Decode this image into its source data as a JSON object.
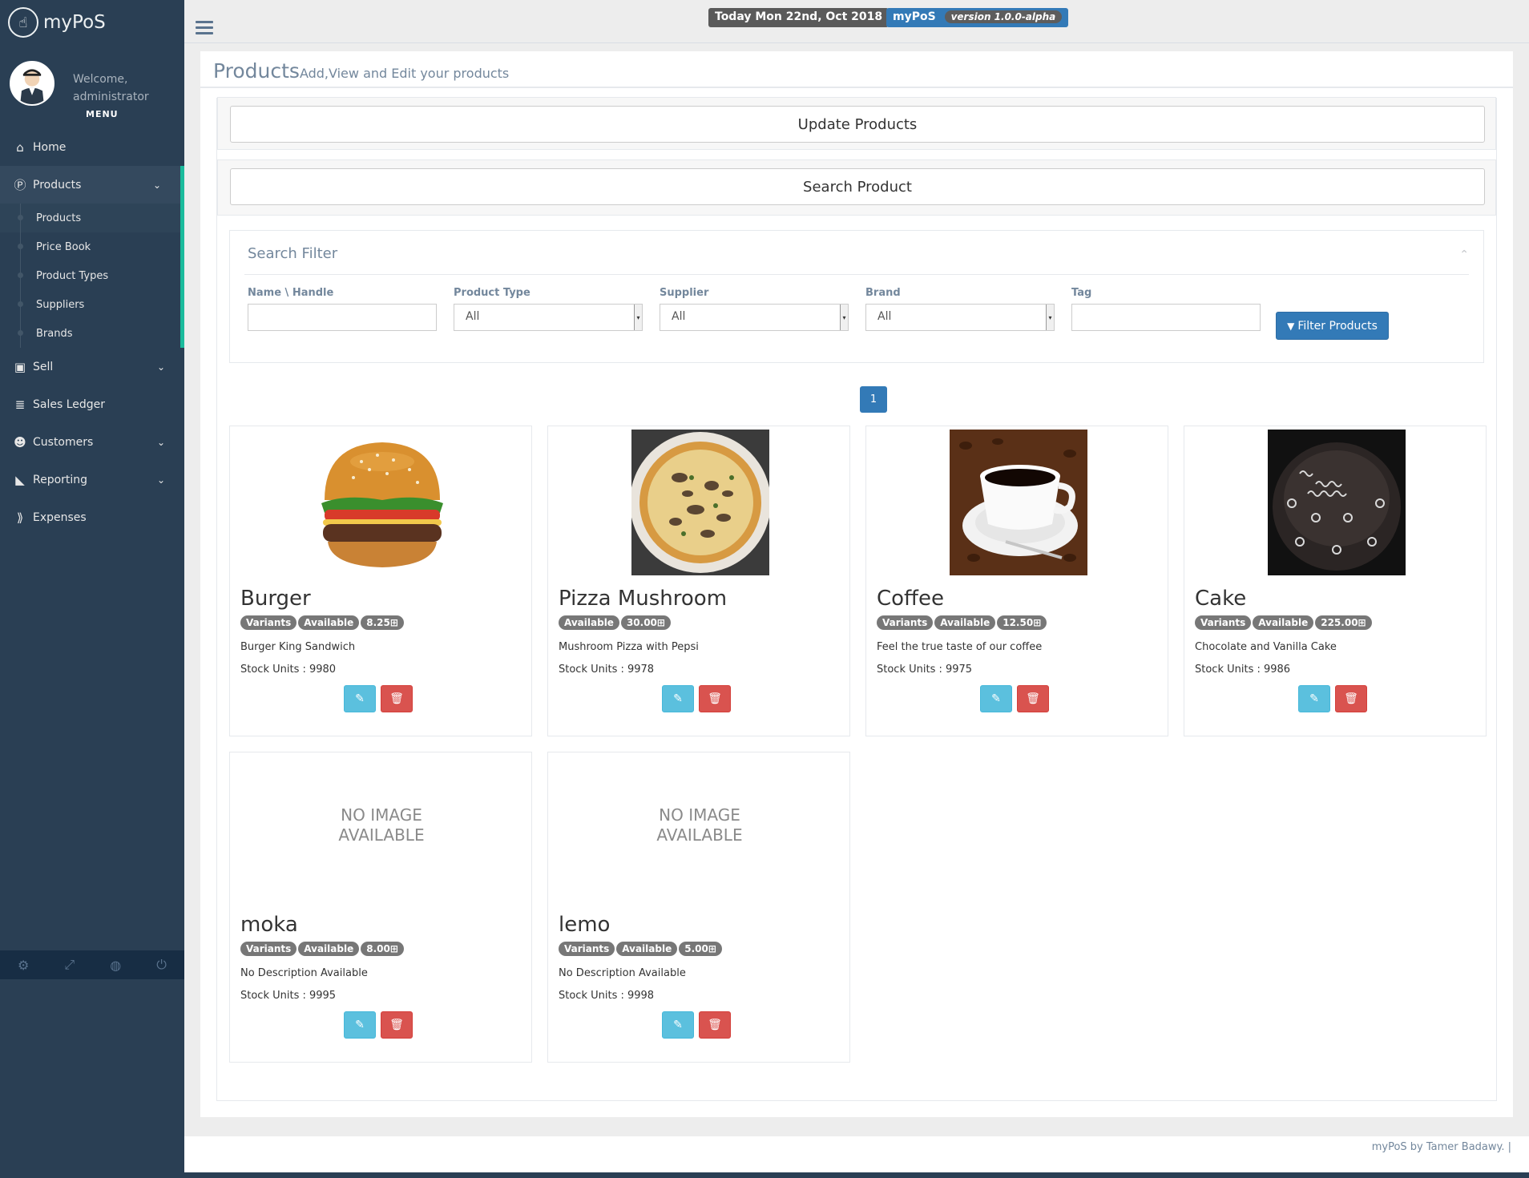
{
  "app": {
    "title": "myPoS",
    "logo_icon": "hand-pointer-icon"
  },
  "profile": {
    "welcome": "Welcome,",
    "user": "administrator",
    "menu_label": "MENU"
  },
  "nav": {
    "home": "Home",
    "products": "Products",
    "sub": [
      "Products",
      "Price Book",
      "Product Types",
      "Suppliers",
      "Brands"
    ],
    "sell": "Sell",
    "sales_ledger": "Sales Ledger",
    "customers": "Customers",
    "reporting": "Reporting",
    "expenses": "Expenses"
  },
  "topbar": {
    "date": "Today Mon 22nd, Oct 2018",
    "app": "myPoS",
    "version": "version 1.0.0-alpha"
  },
  "page": {
    "title": "Products",
    "subtitle": "Add,View and Edit your products"
  },
  "actions": {
    "update": "Update Products",
    "search": "Search Product"
  },
  "filter": {
    "title": "Search Filter",
    "name_label": "Name \\ Handle",
    "name_value": "",
    "type_label": "Product Type",
    "type_value": "All",
    "supplier_label": "Supplier",
    "supplier_value": "All",
    "brand_label": "Brand",
    "brand_value": "All",
    "tag_label": "Tag",
    "tag_value": "",
    "button": "Filter Products"
  },
  "pagination": {
    "current": "1"
  },
  "common": {
    "variants": "Variants",
    "available": "Available",
    "no_image_1": "NO IMAGE",
    "no_image_2": "AVAILABLE",
    "edit_icon": "pencil-icon",
    "delete_icon": "trash-icon"
  },
  "products": [
    {
      "name": "Burger",
      "price": "8.25⊞",
      "description": "Burger King Sandwich",
      "stock": "Stock Units : 9980"
    },
    {
      "name": "Pizza Mushroom",
      "price": "30.00⊞",
      "description": "Mushroom Pizza with Pepsi",
      "stock": "Stock Units : 9978"
    },
    {
      "name": "Coffee",
      "price": "12.50⊞",
      "description": "Feel the true taste of our coffee",
      "stock": "Stock Units : 9975"
    },
    {
      "name": "Cake",
      "price": "225.00⊞",
      "description": "Chocolate and Vanilla Cake",
      "stock": "Stock Units : 9986"
    },
    {
      "name": "moka",
      "price": "8.00⊞",
      "description": "No Description Available",
      "stock": "Stock Units : 9995"
    },
    {
      "name": "lemo",
      "price": "5.00⊞",
      "description": "No Description Available",
      "stock": "Stock Units : 9998"
    }
  ],
  "footer": {
    "text": "myPoS by Tamer Badawy. |"
  },
  "colors": {
    "sidebar": "#2a3f54",
    "accent": "#1abb9c",
    "primary": "#337ab7",
    "info": "#5bc0de",
    "danger": "#d9534f"
  }
}
